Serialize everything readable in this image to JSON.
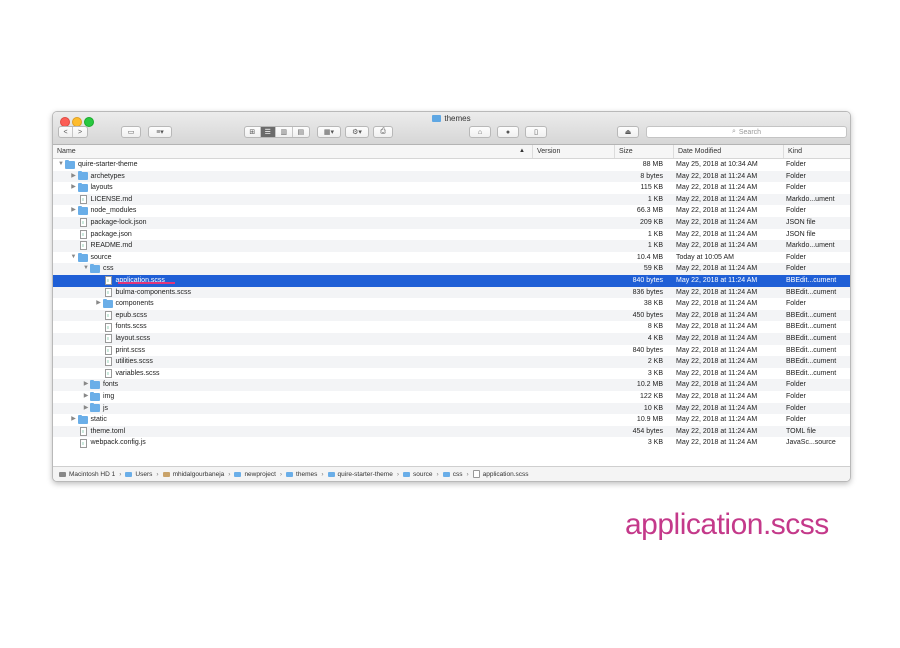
{
  "window": {
    "title": "themes"
  },
  "toolbar": {
    "back": "<",
    "forward": ">",
    "search_placeholder": "Search"
  },
  "columns": {
    "name": "Name",
    "version": "Version",
    "size": "Size",
    "date": "Date Modified",
    "kind": "Kind"
  },
  "rows": [
    {
      "name": "quire-starter-theme",
      "size": "88 MB",
      "date": "May 25, 2018 at 10:34 AM",
      "kind": "Folder",
      "level": 0,
      "type": "folder",
      "expanded": true
    },
    {
      "name": "archetypes",
      "size": "8 bytes",
      "date": "May 22, 2018 at 11:24 AM",
      "kind": "Folder",
      "level": 1,
      "type": "folder",
      "expanded": false
    },
    {
      "name": "layouts",
      "size": "115 KB",
      "date": "May 22, 2018 at 11:24 AM",
      "kind": "Folder",
      "level": 1,
      "type": "folder",
      "expanded": false
    },
    {
      "name": "LICENSE.md",
      "size": "1 KB",
      "date": "May 22, 2018 at 11:24 AM",
      "kind": "Markdo...ument",
      "level": 1,
      "type": "file"
    },
    {
      "name": "node_modules",
      "size": "66.3 MB",
      "date": "May 22, 2018 at 11:24 AM",
      "kind": "Folder",
      "level": 1,
      "type": "folder",
      "expanded": false
    },
    {
      "name": "package-lock.json",
      "size": "209 KB",
      "date": "May 22, 2018 at 11:24 AM",
      "kind": "JSON file",
      "level": 1,
      "type": "file"
    },
    {
      "name": "package.json",
      "size": "1 KB",
      "date": "May 22, 2018 at 11:24 AM",
      "kind": "JSON file",
      "level": 1,
      "type": "file"
    },
    {
      "name": "README.md",
      "size": "1 KB",
      "date": "May 22, 2018 at 11:24 AM",
      "kind": "Markdo...ument",
      "level": 1,
      "type": "file"
    },
    {
      "name": "source",
      "size": "10.4 MB",
      "date": "Today at 10:05 AM",
      "kind": "Folder",
      "level": 1,
      "type": "folder",
      "expanded": true
    },
    {
      "name": "css",
      "size": "59 KB",
      "date": "May 22, 2018 at 11:24 AM",
      "kind": "Folder",
      "level": 2,
      "type": "folder",
      "expanded": true
    },
    {
      "name": "application.scss",
      "size": "840 bytes",
      "date": "May 22, 2018 at 11:24 AM",
      "kind": "BBEdit...cument",
      "level": 3,
      "type": "file",
      "selected": true
    },
    {
      "name": "bulma-components.scss",
      "size": "836 bytes",
      "date": "May 22, 2018 at 11:24 AM",
      "kind": "BBEdit...cument",
      "level": 3,
      "type": "file"
    },
    {
      "name": "components",
      "size": "38 KB",
      "date": "May 22, 2018 at 11:24 AM",
      "kind": "Folder",
      "level": 3,
      "type": "folder",
      "expanded": false
    },
    {
      "name": "epub.scss",
      "size": "450 bytes",
      "date": "May 22, 2018 at 11:24 AM",
      "kind": "BBEdit...cument",
      "level": 3,
      "type": "file"
    },
    {
      "name": "fonts.scss",
      "size": "8 KB",
      "date": "May 22, 2018 at 11:24 AM",
      "kind": "BBEdit...cument",
      "level": 3,
      "type": "file"
    },
    {
      "name": "layout.scss",
      "size": "4 KB",
      "date": "May 22, 2018 at 11:24 AM",
      "kind": "BBEdit...cument",
      "level": 3,
      "type": "file"
    },
    {
      "name": "print.scss",
      "size": "840 bytes",
      "date": "May 22, 2018 at 11:24 AM",
      "kind": "BBEdit...cument",
      "level": 3,
      "type": "file"
    },
    {
      "name": "utilities.scss",
      "size": "2 KB",
      "date": "May 22, 2018 at 11:24 AM",
      "kind": "BBEdit...cument",
      "level": 3,
      "type": "file"
    },
    {
      "name": "variables.scss",
      "size": "3 KB",
      "date": "May 22, 2018 at 11:24 AM",
      "kind": "BBEdit...cument",
      "level": 3,
      "type": "file"
    },
    {
      "name": "fonts",
      "size": "10.2 MB",
      "date": "May 22, 2018 at 11:24 AM",
      "kind": "Folder",
      "level": 2,
      "type": "folder",
      "expanded": false
    },
    {
      "name": "img",
      "size": "122 KB",
      "date": "May 22, 2018 at 11:24 AM",
      "kind": "Folder",
      "level": 2,
      "type": "folder",
      "expanded": false
    },
    {
      "name": "js",
      "size": "10 KB",
      "date": "May 22, 2018 at 11:24 AM",
      "kind": "Folder",
      "level": 2,
      "type": "folder",
      "expanded": false
    },
    {
      "name": "static",
      "size": "10.9 MB",
      "date": "May 22, 2018 at 11:24 AM",
      "kind": "Folder",
      "level": 1,
      "type": "folder",
      "expanded": false
    },
    {
      "name": "theme.toml",
      "size": "454 bytes",
      "date": "May 22, 2018 at 11:24 AM",
      "kind": "TOML file",
      "level": 1,
      "type": "file"
    },
    {
      "name": "webpack.config.js",
      "size": "3 KB",
      "date": "May 22, 2018 at 11:24 AM",
      "kind": "JavaSc...source",
      "level": 1,
      "type": "file"
    }
  ],
  "pathbar": [
    "Macintosh HD 1",
    "Users",
    "mhidalgourbaneja",
    "newproject",
    "themes",
    "quire-starter-theme",
    "source",
    "css",
    "application.scss"
  ],
  "caption": "application.scss",
  "colors": {
    "selection": "#1f5fd6",
    "caption": "#c4398a",
    "folder": "#6aaee8"
  }
}
